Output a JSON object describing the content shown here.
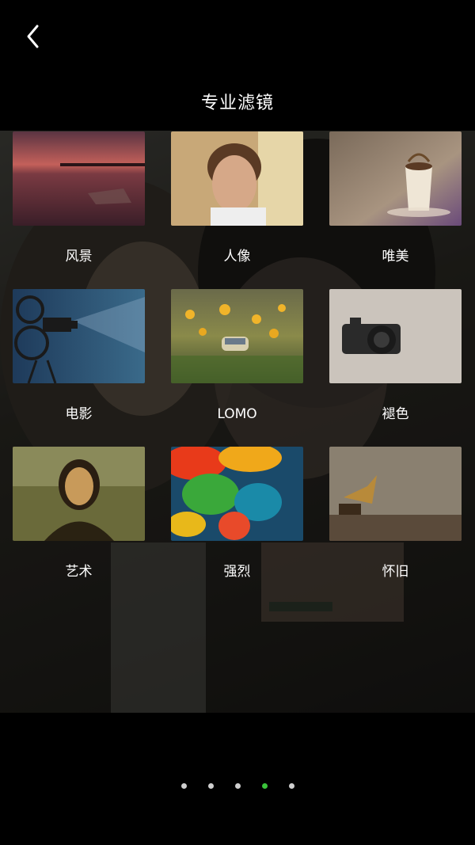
{
  "header": {
    "title": "专业滤镜"
  },
  "filters": [
    {
      "label": "风景",
      "image": "landscape-sunset-boat"
    },
    {
      "label": "人像",
      "image": "portrait-man"
    },
    {
      "label": "唯美",
      "image": "coffee-cup-splash"
    },
    {
      "label": "电影",
      "image": "film-projector"
    },
    {
      "label": "LOMO",
      "image": "dandelion-field-car"
    },
    {
      "label": "褪色",
      "image": "vintage-camera"
    },
    {
      "label": "艺术",
      "image": "mona-lisa-painting"
    },
    {
      "label": "强烈",
      "image": "colorful-ink-smoke"
    },
    {
      "label": "怀旧",
      "image": "gramophone"
    }
  ],
  "pagination": {
    "count": 5,
    "active_index": 3
  },
  "colors": {
    "active_dot": "#3ac33a",
    "inactive_dot": "#cfcfcf",
    "background": "#000000"
  }
}
